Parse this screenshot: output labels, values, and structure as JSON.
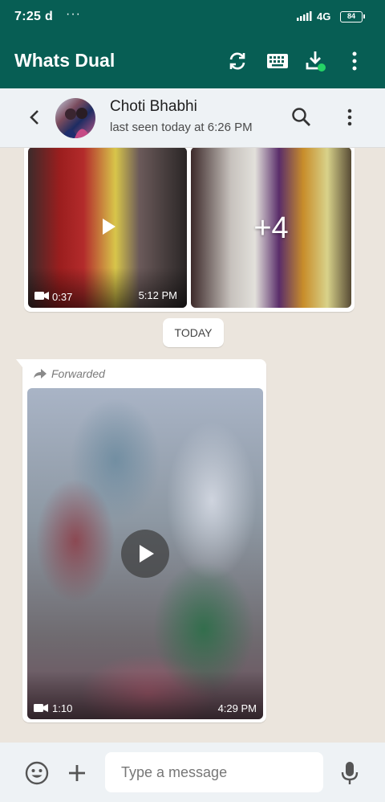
{
  "status_bar": {
    "time": "7:25",
    "carrier_glyph": "d",
    "more": "···",
    "network": "4G",
    "battery": "84"
  },
  "app_bar": {
    "title": "Whats Dual"
  },
  "chat_header": {
    "name": "Choti Bhabhi",
    "status": "last seen today at 6:26 PM"
  },
  "messages": {
    "media_group": {
      "video_duration": "0:37",
      "time": "5:12 PM",
      "more_count": "+4"
    },
    "date_separator": "TODAY",
    "forwarded_video": {
      "forwarded_label": "Forwarded",
      "duration": "1:10",
      "time": "4:29 PM"
    }
  },
  "composer": {
    "placeholder": "Type a message"
  },
  "colors": {
    "primary": "#075e54",
    "chat_bg": "#ece5dd",
    "header_bg": "#eef2f5"
  }
}
